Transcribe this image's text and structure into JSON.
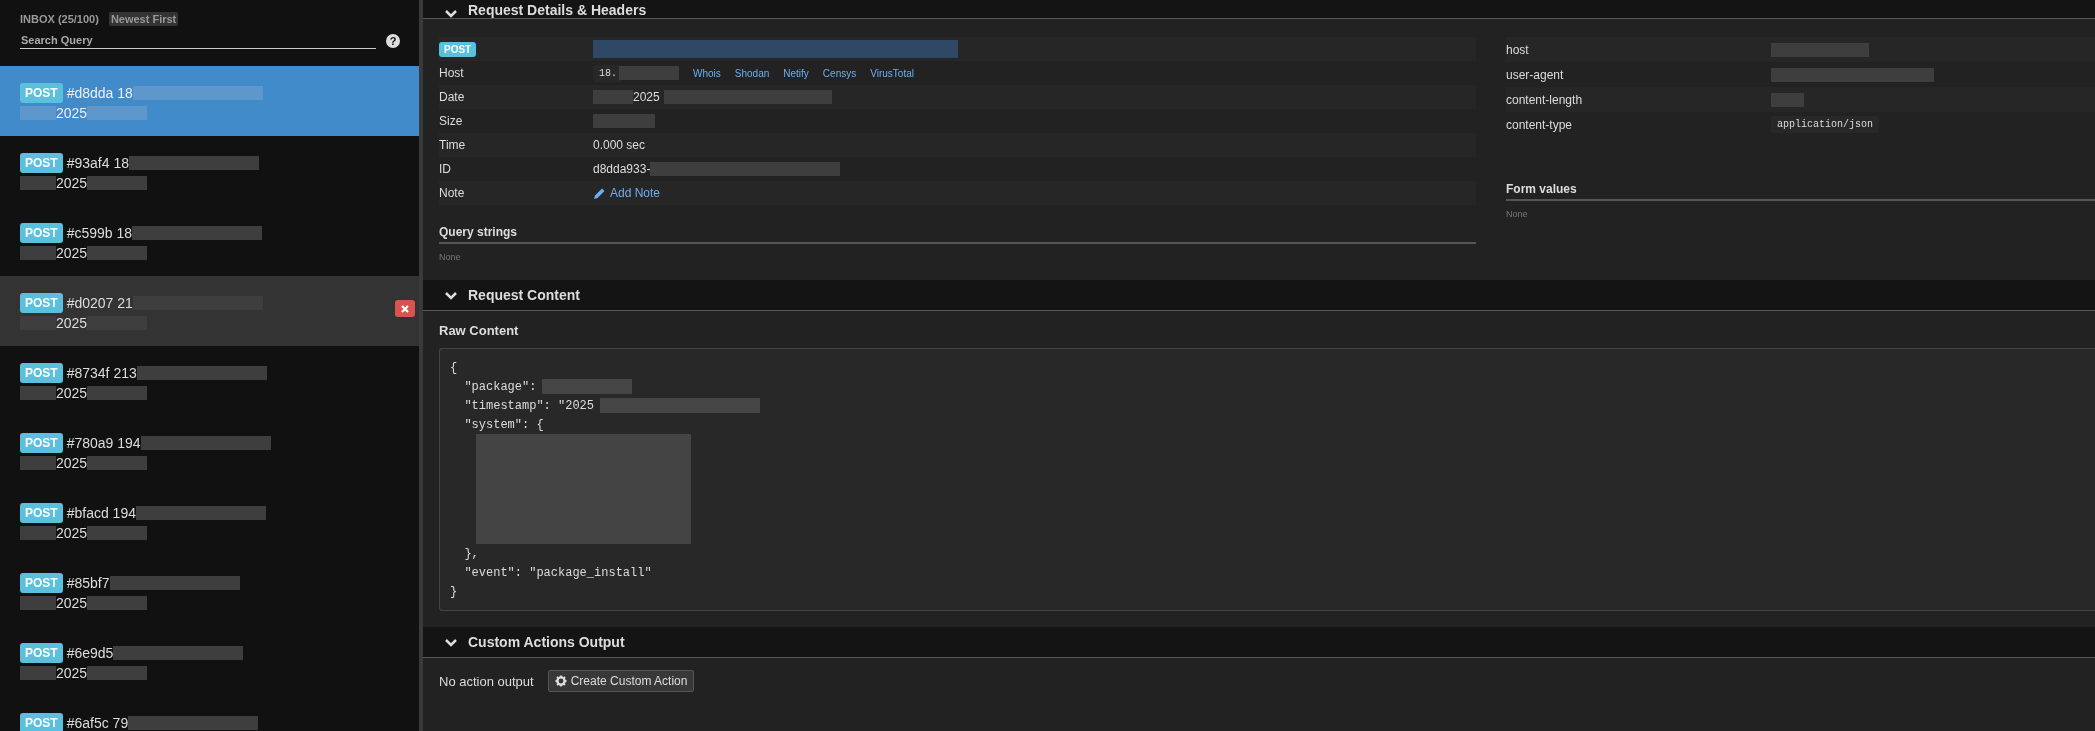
{
  "inbox": {
    "title": "INBOX (25/100)",
    "sort": "Newest First",
    "search": {
      "placeholder": "Search Query"
    },
    "help": "?",
    "requests": [
      {
        "method": "POST",
        "title": "#d8dda 18",
        "date": "2025",
        "selected": true,
        "hovered": false
      },
      {
        "method": "POST",
        "title": "#93af4 18",
        "date": "2025",
        "selected": false,
        "hovered": false
      },
      {
        "method": "POST",
        "title": "#c599b 18",
        "date": "2025",
        "selected": false,
        "hovered": false
      },
      {
        "method": "POST",
        "title": "#d0207 21",
        "date": "2025",
        "selected": false,
        "hovered": true
      },
      {
        "method": "POST",
        "title": "#8734f 213",
        "date": "2025",
        "selected": false,
        "hovered": false
      },
      {
        "method": "POST",
        "title": "#780a9 194",
        "date": "2025",
        "selected": false,
        "hovered": false
      },
      {
        "method": "POST",
        "title": "#bfacd 194",
        "date": "2025",
        "selected": false,
        "hovered": false
      },
      {
        "method": "POST",
        "title": "#85bf7",
        "date": "2025",
        "selected": false,
        "hovered": false
      },
      {
        "method": "POST",
        "title": "#6e9d5",
        "date": "2025",
        "selected": false,
        "hovered": false
      },
      {
        "method": "POST",
        "title": "#6af5c 79",
        "selected": false,
        "hovered": false
      }
    ]
  },
  "details": {
    "title": "Request Details & Headers",
    "rows": [
      {
        "kind": "method",
        "label": "POST"
      },
      {
        "kind": "host",
        "label": "Host",
        "value": "18.",
        "links": [
          "Whois",
          "Shodan",
          "Netify",
          "Censys",
          "VirusTotal"
        ]
      },
      {
        "kind": "date",
        "label": "Date",
        "value": "2025"
      },
      {
        "kind": "text",
        "label": "Size"
      },
      {
        "kind": "text",
        "label": "Time",
        "value": "0.000 sec"
      },
      {
        "kind": "text",
        "label": "ID",
        "value": "d8dda933-"
      },
      {
        "kind": "note",
        "label": "Note",
        "value": "Add Note"
      }
    ],
    "headers": [
      {
        "name": "host"
      },
      {
        "name": "user-agent"
      },
      {
        "name": "content-length"
      },
      {
        "name": "content-type",
        "value": "application/json"
      }
    ],
    "query": {
      "title": "Query strings",
      "value": "None"
    },
    "form": {
      "title": "Form values",
      "value": "None"
    }
  },
  "content": {
    "title": "Request Content",
    "subtitle": "Raw Content",
    "lines": [
      {
        "text": "{",
        "redacted": false
      },
      {
        "text": "  \"package\":",
        "redacted": true
      },
      {
        "text": "  \"timestamp\": \"2025",
        "redacted": true
      },
      {
        "text": "  \"system\": {",
        "redacted": false
      },
      {
        "text": "  },",
        "redacted": false
      },
      {
        "text": "  \"event\": \"package_install\"",
        "redacted": false
      },
      {
        "text": "}",
        "redacted": false
      }
    ]
  },
  "actions": {
    "title": "Custom Actions Output",
    "empty": "No action output",
    "button": "Create Custom Action"
  }
}
